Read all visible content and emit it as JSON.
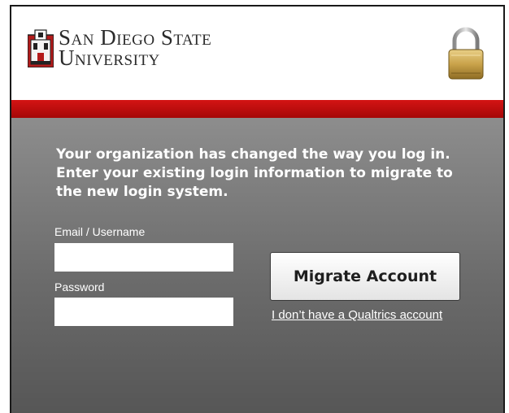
{
  "header": {
    "university_line1": "San Diego State",
    "university_line2": "University",
    "brand_color": "#c30c0c"
  },
  "form": {
    "message": "Your organization has changed the way you log in. Enter your existing login information to migrate to the new login system.",
    "email_label": "Email / Username",
    "email_value": "",
    "password_label": "Password",
    "password_value": "",
    "migrate_button": "Migrate Account",
    "no_account_link": "I don’t have a Qualtrics account"
  },
  "icons": {
    "logo": "sdsu-seal-icon",
    "security": "padlock-icon"
  }
}
